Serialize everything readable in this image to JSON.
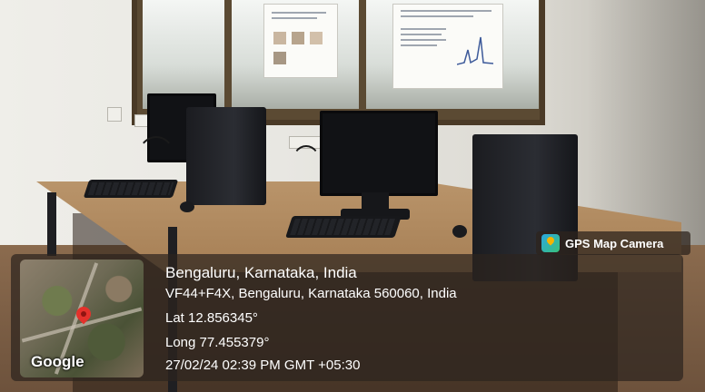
{
  "badge": {
    "app_name": "GPS Map Camera",
    "icon": "gps-map-camera-icon"
  },
  "map": {
    "provider": "Google",
    "icon": "location-pin-icon"
  },
  "location": {
    "place": "Bengaluru, Karnataka, India",
    "address": "VF44+F4X, Bengaluru, Karnataka 560060, India",
    "latitude": "Lat 12.856345°",
    "longitude": "Long 77.455379°",
    "timestamp": "27/02/24 02:39 PM GMT +05:30"
  },
  "colors": {
    "overlay": "#2d241e",
    "pin": "#e4312b",
    "text": "#ffffff"
  }
}
